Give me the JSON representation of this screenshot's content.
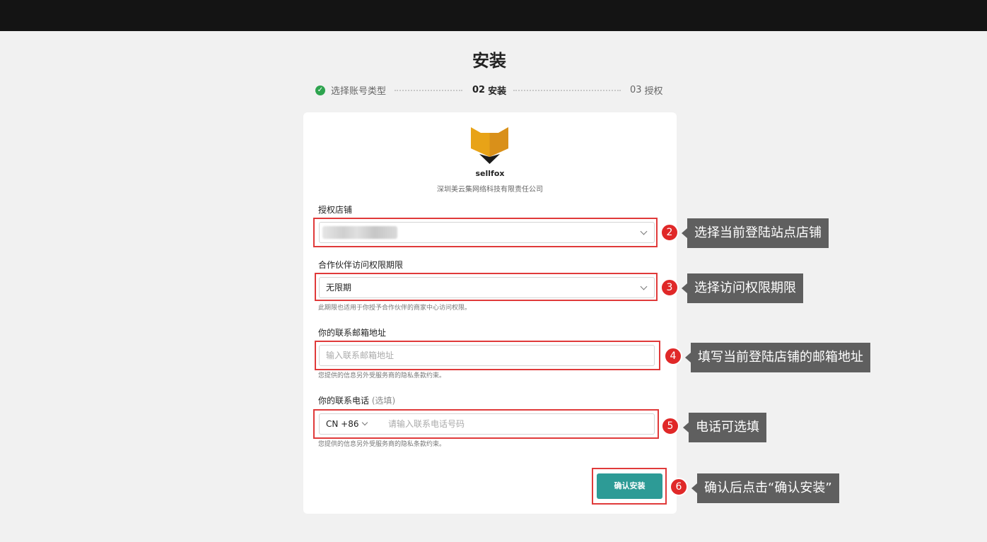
{
  "page": {
    "title": "安装"
  },
  "steps": [
    {
      "label": "选择账号类型",
      "state": "done",
      "icon": "check-icon"
    },
    {
      "num": "02",
      "label": "安装",
      "state": "active"
    },
    {
      "num": "03",
      "label": "授权",
      "state": "pending"
    }
  ],
  "app": {
    "name": "sellfox",
    "company": "深圳美云集网络科技有限责任公司",
    "logo_icon": "fox-logo-icon",
    "logo_colors": [
      "#E8A317",
      "#1a1a1a"
    ]
  },
  "form": {
    "store": {
      "label": "授权店铺",
      "value": ""
    },
    "access": {
      "label": "合作伙伴访问权限期限",
      "value": "无限期",
      "hint": "此期限也适用于你授予合作伙伴的商家中心访问权限。"
    },
    "email": {
      "label": "你的联系邮箱地址",
      "placeholder": "输入联系邮箱地址",
      "hint": "您提供的信息另外受服务商的隐私条款约束。"
    },
    "phone": {
      "label": "你的联系电话",
      "optional": "(选填)",
      "prefix": "CN +86",
      "placeholder": "请输入联系电话号码",
      "hint": "您提供的信息另外受服务商的隐私条款约束。"
    },
    "confirm_label": "确认安装"
  },
  "annotations": [
    {
      "num": "2",
      "text": "选择当前登陆站点店铺"
    },
    {
      "num": "3",
      "text": "选择访问权限期限"
    },
    {
      "num": "4",
      "text": "填写当前登陆店铺的邮箱地址"
    },
    {
      "num": "5",
      "text": "电话可选填"
    },
    {
      "num": "6",
      "text": "确认后点击“确认安装”"
    }
  ],
  "colors": {
    "accent": "#2d9b96",
    "highlight": "#e03a3a",
    "callout_bg": "#5f5f5f",
    "check": "#2ea44f"
  }
}
